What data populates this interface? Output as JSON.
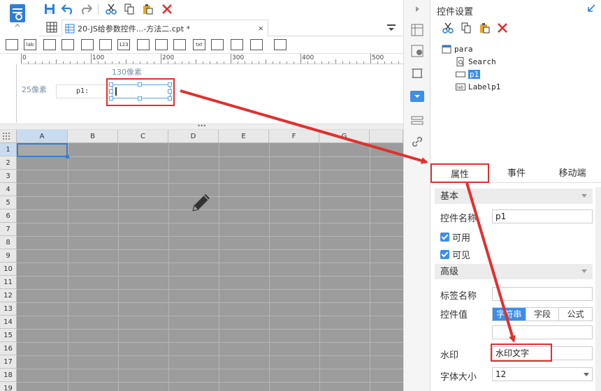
{
  "file_tab": {
    "label": "20-JS给参数控件...-方法二.cpt *",
    "close": "×"
  },
  "widget_bar": {
    "items": [
      "",
      "lab",
      "",
      "",
      "",
      "",
      "123",
      "",
      "",
      "",
      "txt",
      "",
      "",
      "",
      ""
    ]
  },
  "ruler": {
    "ticks": [
      "0",
      "100",
      "200",
      "300",
      "400",
      "500"
    ]
  },
  "param_pane": {
    "width_label": "130像素",
    "height_label": "25像素",
    "p1_label": "p1:"
  },
  "sheet": {
    "columns": [
      "A",
      "B",
      "C",
      "D",
      "E",
      "F",
      "G"
    ],
    "rows": [
      "1",
      "2",
      "3",
      "4",
      "5",
      "6",
      "7",
      "8",
      "9",
      "10",
      "11",
      "12",
      "13",
      "14",
      "15",
      "16",
      "17",
      "18",
      "19"
    ]
  },
  "panel": {
    "title": "控件设置",
    "tree": [
      {
        "label": "para",
        "icon": "form-icon"
      },
      {
        "label": "Search",
        "icon": "search-doc-icon"
      },
      {
        "label": "p1",
        "icon": "textbox-icon"
      },
      {
        "label": "Labelp1",
        "icon": "label-icon"
      }
    ],
    "tabs": [
      "属性",
      "事件",
      "移动端"
    ],
    "basic": {
      "section": "基本",
      "name_label": "控件名称",
      "name_value": "p1",
      "enabled_label": "可用",
      "visible_label": "可见"
    },
    "advanced": {
      "section": "高级",
      "tag_label": "标签名称",
      "tag_value": "",
      "value_label": "控件值",
      "value_modes": [
        "字符串",
        "字段",
        "公式"
      ],
      "value_text": "",
      "watermark_label": "水印",
      "watermark_value": "水印文字",
      "font_size_label": "字体大小",
      "font_size_value": "12"
    }
  },
  "colors": {
    "accent": "#3c8ee8",
    "highlight": "#e03030",
    "sheet_bg": "#9c9c9c"
  }
}
